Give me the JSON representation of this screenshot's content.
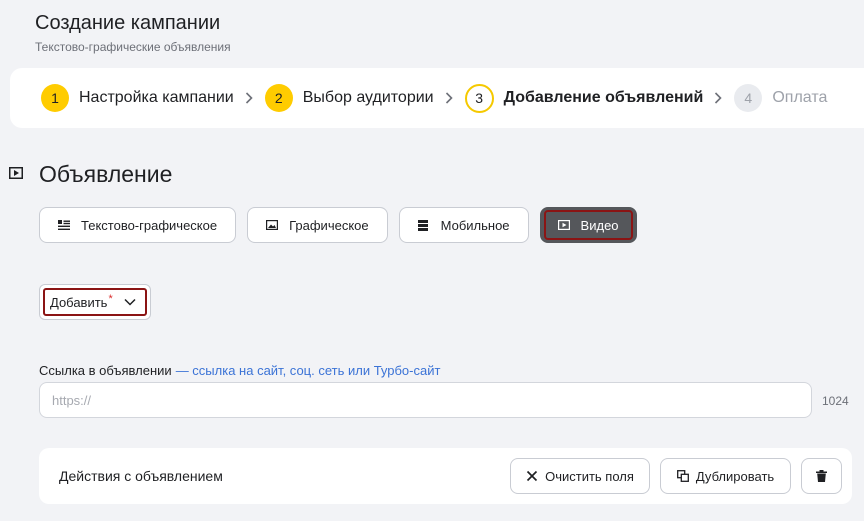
{
  "header": {
    "title": "Создание кампании",
    "subtitle": "Текстово-графические объявления"
  },
  "stepper": {
    "steps": [
      {
        "num": "1",
        "label": "Настройка кампании",
        "state": "done"
      },
      {
        "num": "2",
        "label": "Выбор аудитории",
        "state": "done"
      },
      {
        "num": "3",
        "label": "Добавление объявлений",
        "state": "current"
      },
      {
        "num": "4",
        "label": "Оплата",
        "state": "future"
      }
    ]
  },
  "ad_section": {
    "title": "Объявление",
    "icon": "play-square-icon",
    "types": [
      {
        "label": "Текстово-графическое",
        "icon": "text-image-icon",
        "active": false
      },
      {
        "label": "Графическое",
        "icon": "image-icon",
        "active": false
      },
      {
        "label": "Мобильное",
        "icon": "mobile-icon",
        "active": false
      },
      {
        "label": "Видео",
        "icon": "video-icon",
        "active": true
      }
    ],
    "add_dropdown": {
      "label": "Добавить",
      "required_mark": "*"
    }
  },
  "link_field": {
    "label": "Ссылка в объявлении",
    "hint": "— ссылка на сайт, соц. сеть или Турбо-сайт",
    "placeholder": "https://",
    "value": "",
    "char_limit": "1024"
  },
  "actions": {
    "title": "Действия с объявлением",
    "clear_label": "Очистить поля",
    "duplicate_label": "Дублировать",
    "delete_icon": "trash-icon"
  },
  "colors": {
    "accent": "#ffcc00",
    "active_tab_bg": "#55575b",
    "highlight_border": "#8b1414",
    "link": "#3b73d6"
  }
}
